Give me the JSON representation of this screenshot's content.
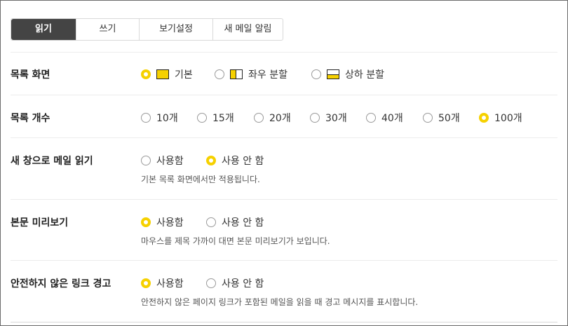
{
  "tabs": [
    {
      "label": "읽기",
      "active": true
    },
    {
      "label": "쓰기",
      "active": false
    },
    {
      "label": "보기설정",
      "active": false
    },
    {
      "label": "새 메일 알림",
      "active": false
    }
  ],
  "list_view": {
    "label": "목록 화면",
    "options": [
      {
        "label": "기본",
        "icon": "layout-basic-icon",
        "selected": true
      },
      {
        "label": "좌우 분할",
        "icon": "layout-left-right-icon",
        "selected": false
      },
      {
        "label": "상하 분할",
        "icon": "layout-top-bottom-icon",
        "selected": false
      }
    ]
  },
  "list_count": {
    "label": "목록 개수",
    "options": [
      {
        "label": "10개",
        "selected": false
      },
      {
        "label": "15개",
        "selected": false
      },
      {
        "label": "20개",
        "selected": false
      },
      {
        "label": "30개",
        "selected": false
      },
      {
        "label": "40개",
        "selected": false
      },
      {
        "label": "50개",
        "selected": false
      },
      {
        "label": "100개",
        "selected": true
      }
    ]
  },
  "new_window": {
    "label": "새 창으로 메일 읽기",
    "options": [
      {
        "label": "사용함",
        "selected": false
      },
      {
        "label": "사용 안 함",
        "selected": true
      }
    ],
    "description": "기본 목록 화면에서만 적용됩니다."
  },
  "preview": {
    "label": "본문 미리보기",
    "options": [
      {
        "label": "사용함",
        "selected": true
      },
      {
        "label": "사용 안 함",
        "selected": false
      }
    ],
    "description": "마우스를 제목 가까이 대면 본문 미리보기가 보입니다."
  },
  "unsafe_link": {
    "label": "안전하지 않은 링크 경고",
    "options": [
      {
        "label": "사용함",
        "selected": true
      },
      {
        "label": "사용 안 함",
        "selected": false
      }
    ],
    "description": "안전하지 않은 페이지 링크가 포함된 메일을 읽을 때 경고 메시지를 표시합니다."
  },
  "colors": {
    "accent": "#f6d100",
    "active_tab": "#444444"
  }
}
